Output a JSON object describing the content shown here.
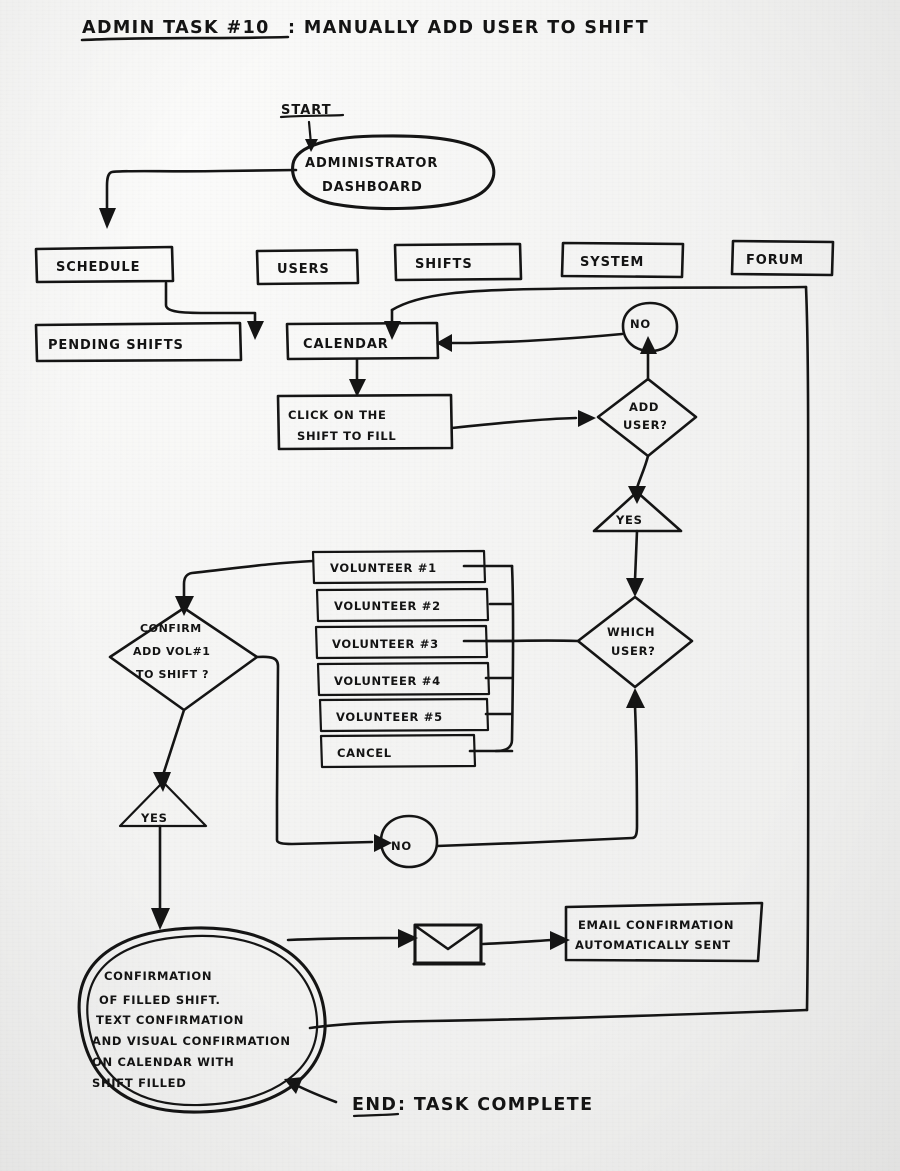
{
  "document": {
    "title_prefix": "ADMIN TASK #10",
    "title_rest": ": MANUALLY ADD  USER TO SHIFT",
    "title_full": "ADMIN TASK #10: MANUALLY ADD USER TO SHIFT",
    "medium": "hand-drawn flowchart on paper",
    "ink_color": "#151515",
    "paper_color": "#f4f4f3"
  },
  "labels": {
    "start": "START",
    "end": "END : TASK COMPLETE",
    "end_prefix": "END",
    "end_rest": ": TASK COMPLETE"
  },
  "nodes": {
    "dashboard": "ADMINISTRATOR",
    "dashboard_line2": "DASHBOARD",
    "pending_shifts": "PENDING SHIFTS",
    "calendar": "CALENDAR",
    "click_shift_l1": "CLICK  ON  THE",
    "click_shift_l2": "SHIFT  TO  FILL",
    "add_user_l1": "ADD",
    "add_user_l2": "USER?",
    "which_user_l1": "WHICH",
    "which_user_l2": "USER?",
    "confirm_l1": "CONFIRM",
    "confirm_l2": "ADD VOL#1",
    "confirm_l3": "TO SHIFT ?",
    "email_l1": "EMAIL  CONFIRMATION",
    "email_l2": "AUTOMATICALLY   SENT",
    "no_1": "NO",
    "no_2": "NO",
    "yes_1": "YES",
    "yes_2": "YES"
  },
  "menu": {
    "items": [
      {
        "label": "SCHEDULE"
      },
      {
        "label": "USERS"
      },
      {
        "label": "SHIFTS"
      },
      {
        "label": "SYSTEM"
      },
      {
        "label": "FORUM"
      }
    ]
  },
  "user_list": {
    "options": [
      {
        "label": "VOLUNTEER #1"
      },
      {
        "label": "VOLUNTEER #2"
      },
      {
        "label": "VOLUNTEER #3"
      },
      {
        "label": "VOLUNTEER #4"
      },
      {
        "label": "VOLUNTEER #5"
      },
      {
        "label": "CANCEL"
      }
    ]
  },
  "confirmation_blob": {
    "lines": [
      "CONFIRMATION",
      "OF FILLED SHIFT.",
      "TEXT CONFIRMATION",
      "AND VISUAL CONFIRMATION",
      "ON CALENDAR WITH",
      "SHIFT FILLED"
    ]
  },
  "icons": {
    "envelope": "envelope-icon"
  }
}
